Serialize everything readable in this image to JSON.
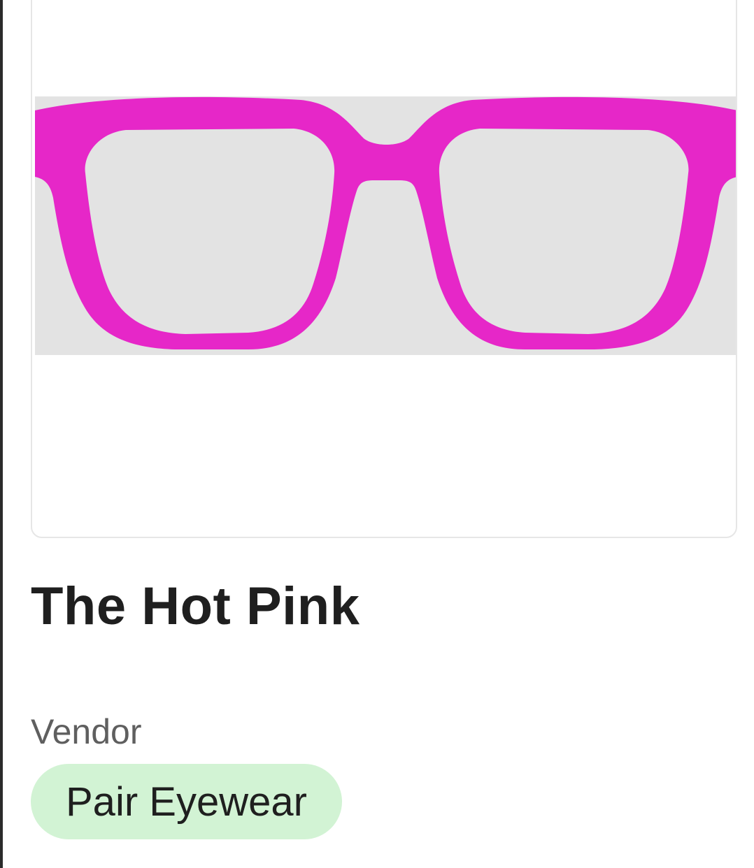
{
  "product": {
    "title": "The Hot Pink",
    "vendor_label": "Vendor",
    "vendor_name": "Pair Eyewear",
    "image": {
      "subject": "glasses-icon",
      "frame_color": "#e627c8",
      "background_color": "#e3e3e3"
    }
  },
  "colors": {
    "vendor_badge_bg": "#d2f3d4",
    "title_text": "#1f1f1f",
    "label_text": "#5f5f5f"
  }
}
